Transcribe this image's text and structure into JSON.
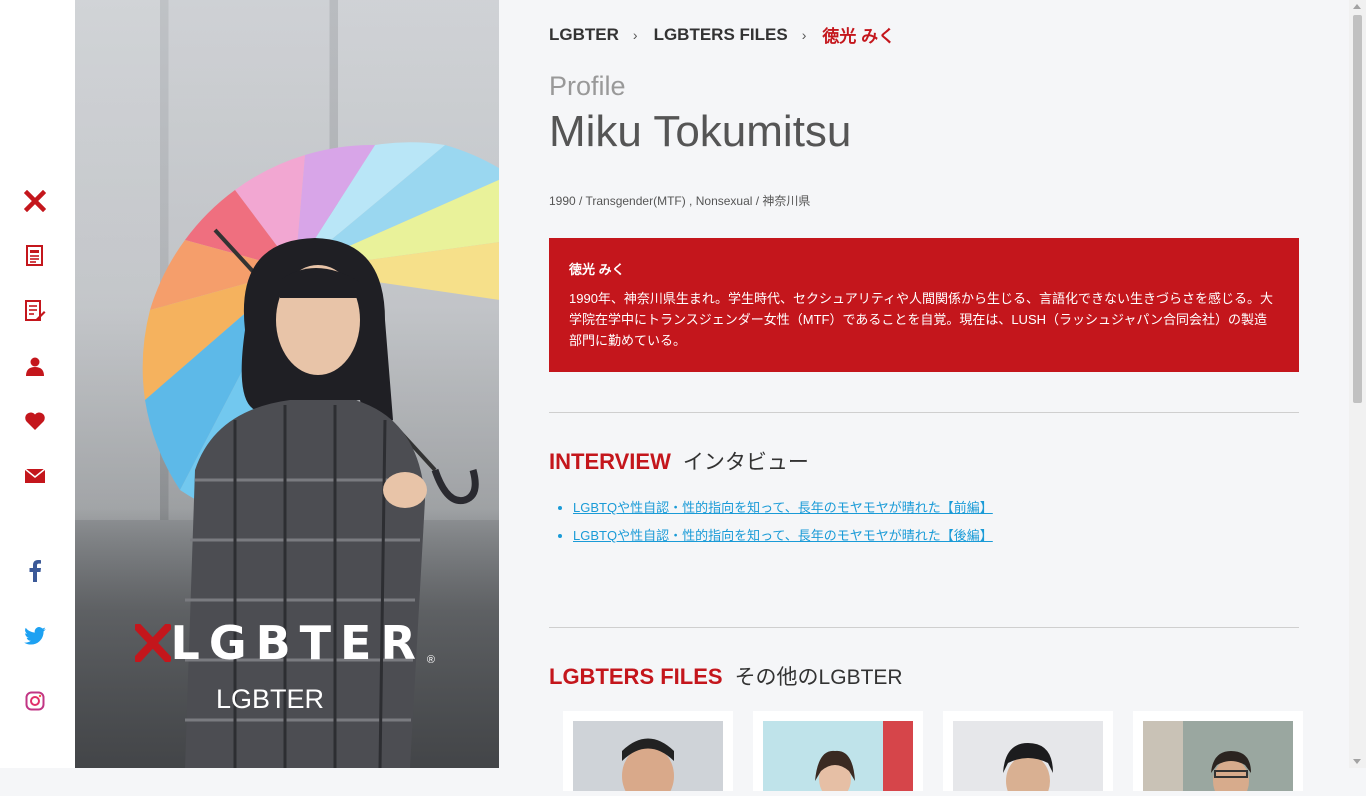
{
  "colors": {
    "accent": "#c4161c",
    "link": "#1a9bd7",
    "facebook": "#3b5998",
    "twitter": "#1da1f2",
    "instagram": "#c13584"
  },
  "rail": {
    "icons": [
      "x-logo-icon",
      "document-icon",
      "edit-document-icon",
      "user-icon",
      "heart-icon",
      "mail-icon",
      "facebook-icon",
      "twitter-icon",
      "instagram-icon"
    ]
  },
  "hero": {
    "brand_text": "LGBTER",
    "brand_reg": "®",
    "brand_sub": "LGBTER"
  },
  "breadcrumb": {
    "items": [
      "LGBTER",
      "LGBTERS FILES"
    ],
    "current": "徳光 みく",
    "separator": "›"
  },
  "profile": {
    "label": "Profile",
    "name": "Miku Tokumitsu",
    "meta": "1990 / Transgender(MTF) , Nonsexual / 神奈川県"
  },
  "bio": {
    "name": "徳光 みく",
    "text": "1990年、神奈川県生まれ。学生時代、セクシュアリティや人間関係から生じる、言語化できない生きづらさを感じる。大学院在学中にトランスジェンダー女性（MTF）であることを自覚。現在は、LUSH（ラッシュジャパン合同会社）の製造部門に勤めている。"
  },
  "interview": {
    "title_en": "INTERVIEW",
    "title_ja": "インタビュー",
    "links": [
      "LGBTQや性自認・性的指向を知って、長年のモヤモヤが晴れた【前編】",
      "LGBTQや性自認・性的指向を知って、長年のモヤモヤが晴れた【後編】"
    ]
  },
  "files": {
    "title_en": "LGBTERS FILES",
    "title_ja": "その他のLGBTER",
    "cards": 4
  }
}
